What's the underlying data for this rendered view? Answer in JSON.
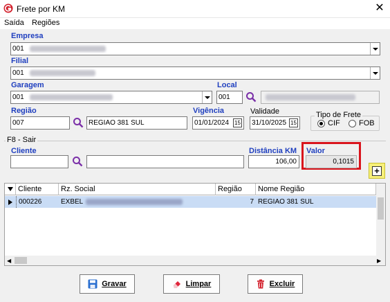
{
  "window": {
    "title": "Frete por KM"
  },
  "menu": {
    "items": [
      "Saída",
      "Regiões"
    ]
  },
  "form": {
    "empresa_label": "Empresa",
    "empresa_value": "001",
    "filial_label": "Filial",
    "filial_value": "001",
    "garagem_label": "Garagem",
    "garagem_value": "001",
    "local_label": "Local",
    "local_value": "001",
    "regiao_label": "Região",
    "regiao_code": "007",
    "regiao_name": "REGIAO 381 SUL",
    "vigencia_label": "Vigência",
    "vigencia_value": "01/01/2024",
    "validade_label": "Validade",
    "validade_value": "31/10/2025",
    "tipo_frete_label": "Tipo de Frete",
    "tipo_cif": "CIF",
    "tipo_fob": "FOB",
    "tipo_selected": "CIF"
  },
  "section": {
    "title": "F8 - Sair"
  },
  "filters": {
    "cliente_label": "Cliente",
    "cliente_value": "",
    "cliente_name": "",
    "distancia_label": "Distância KM",
    "distancia_value": "106,00",
    "valor_label": "Valor",
    "valor_value": "0,1015"
  },
  "grid": {
    "headers": [
      "Cliente",
      "Rz. Social",
      "Região",
      "Nome Região"
    ],
    "rows": [
      {
        "cliente": "000226",
        "rz_social": "EXBEL",
        "regiao": "7",
        "nome_regiao": "REGIAO 381 SUL"
      }
    ]
  },
  "buttons": {
    "gravar": "Gravar",
    "limpar": "Limpar",
    "excluir": "Excluir"
  },
  "colors": {
    "label_blue": "#1f3fbf",
    "highlight_red": "#d9141c",
    "plus_yellow": "#f7f07a",
    "row_selected": "#c9dcf5"
  }
}
